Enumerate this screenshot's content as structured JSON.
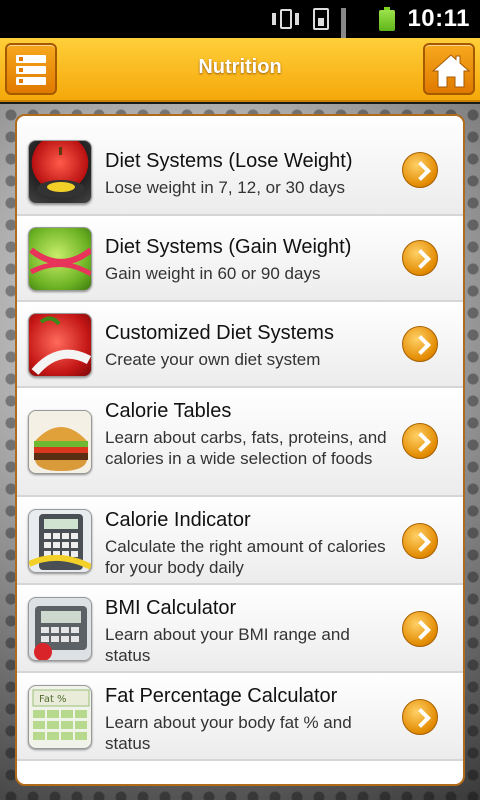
{
  "status_bar": {
    "time": "10:11",
    "icons": [
      "vibrate-icon",
      "sim-icon",
      "signal-icon",
      "battery-icon"
    ]
  },
  "header": {
    "title": "Nutrition",
    "menu_icon": "menu-icon",
    "home_icon": "home-icon",
    "accent": "#f5a80a"
  },
  "items": [
    {
      "title": "Diet Systems (Lose Weight)",
      "subtitle": "Lose weight in 7, 12, or 30 days",
      "icon": "apple-scale-icon"
    },
    {
      "title": "Diet Systems (Gain Weight)",
      "subtitle": "Gain weight in 60 or 90 days",
      "icon": "apple-tape-icon"
    },
    {
      "title": "Customized Diet Systems",
      "subtitle": "Create your own diet system",
      "icon": "apple-measure-icon"
    },
    {
      "title": "Calorie Tables",
      "subtitle": "Learn about carbs, fats, proteins, and calories in a wide selection of foods",
      "icon": "burger-icon"
    },
    {
      "title": "Calorie Indicator",
      "subtitle": "Calculate the right amount of calories for your body daily",
      "icon": "calculator-icon"
    },
    {
      "title": "BMI Calculator",
      "subtitle": "Learn about your BMI range and status",
      "icon": "bmi-scale-icon"
    },
    {
      "title": "Fat Percentage Calculator",
      "subtitle": "Learn about your body fat % and status",
      "icon": "fat-percent-icon",
      "icon_text": "Fat %"
    }
  ]
}
